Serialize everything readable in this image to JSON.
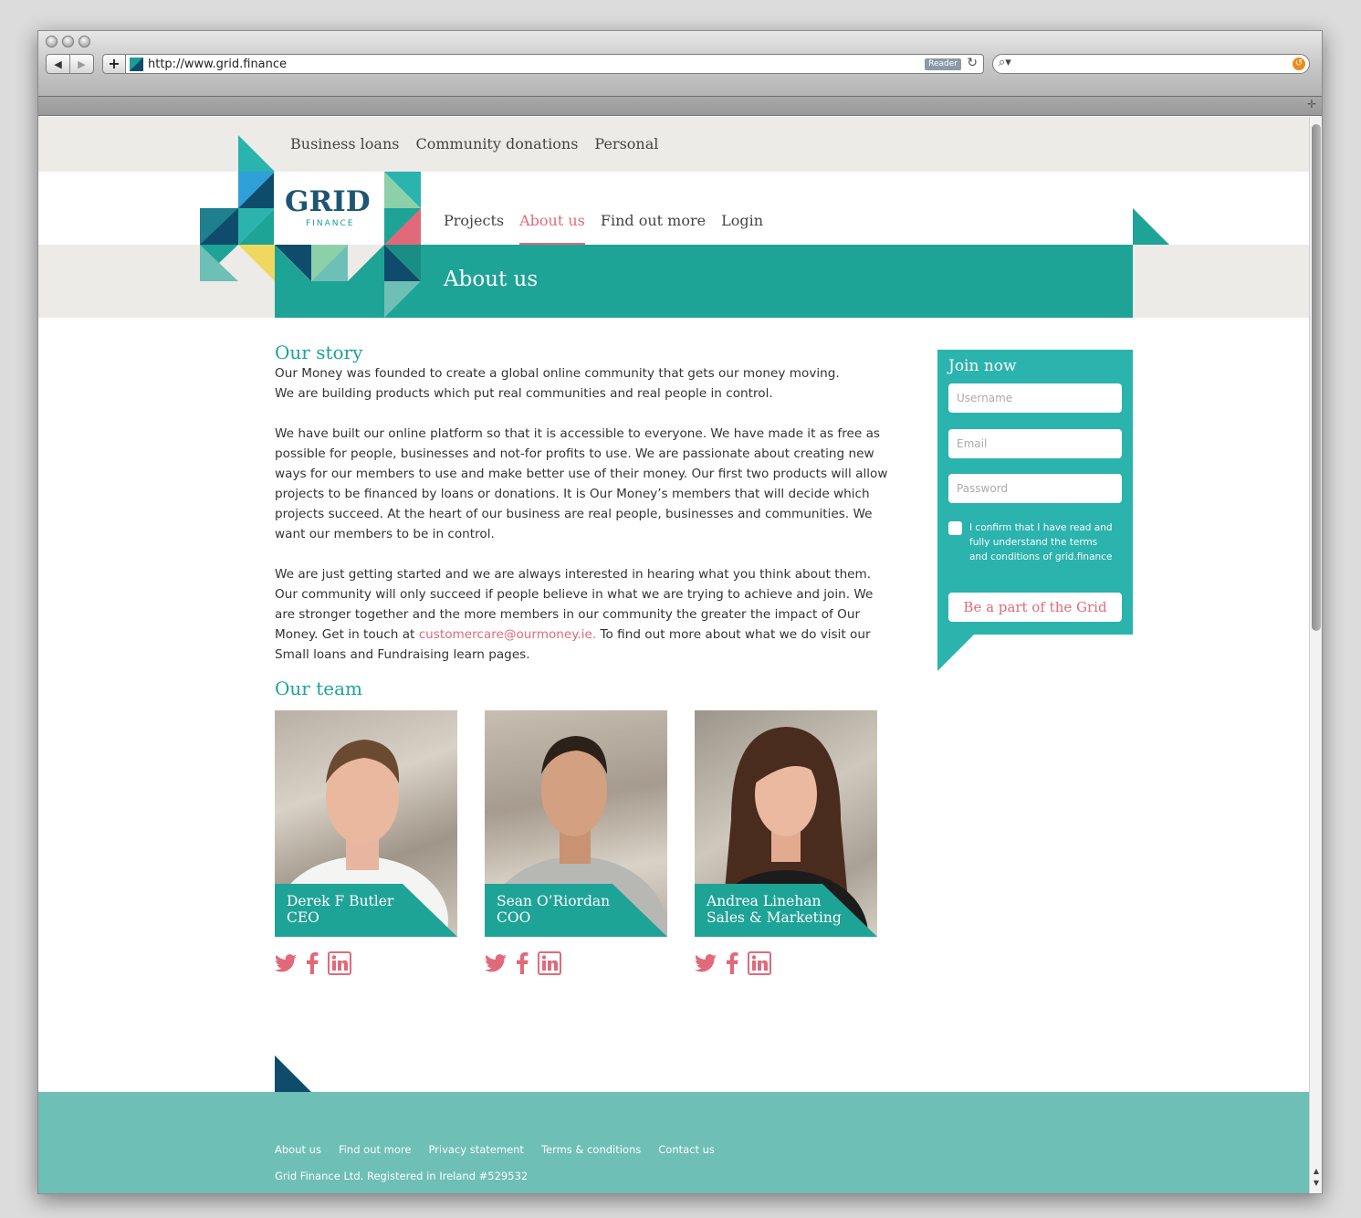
{
  "browser": {
    "url": "http://www.grid.finance",
    "reader_label": "Reader",
    "back_icon": "back-arrow-icon",
    "forward_icon": "forward-arrow-icon"
  },
  "site": {
    "top_nav": [
      "Business loans",
      "Community donations",
      "Personal"
    ],
    "logo_text": "GRID",
    "logo_sub": "FINANCE",
    "main_nav": [
      {
        "label": "Projects",
        "active": false
      },
      {
        "label": "About us",
        "active": true
      },
      {
        "label": "Find out more",
        "active": false
      },
      {
        "label": "Login",
        "active": false
      }
    ],
    "hero_title": "About us"
  },
  "story": {
    "heading": "Our story",
    "p1_line1": "Our Money was founded to create a global online community that gets our money moving.",
    "p1_line2": "We are building products which put real communities and real people in control.",
    "p2": "We have built our online platform so that it is accessible to everyone. We have made it as free as possible for people, businesses and not-for profits to use. We are passionate about creating new ways for our members to use and make better use of their money. Our first two products will allow projects to be financed by loans or donations. It is Our Money’s members that will decide which projects succeed. At the heart of our business are real people, businesses and communities. We want our members to be in control.",
    "p3_before": "We are just getting started and we are always interested in hearing what you think about them. Our community will only succeed if people believe in what we are trying to achieve and join. We are stronger together and the more members in our community the greater the impact of Our Money. Get in touch at ",
    "p3_email": "customercare@ourmoney.ie.",
    "p3_after": " To find out more about what we do visit our Small loans and Fundraising learn pages."
  },
  "team": {
    "heading": "Our team",
    "members": [
      {
        "name": "Derek F Butler",
        "role": "CEO"
      },
      {
        "name": "Sean O’Riordan",
        "role": "COO"
      },
      {
        "name": "Andrea Linehan",
        "role": "Sales & Marketing"
      }
    ]
  },
  "join": {
    "title": "Join now",
    "username_placeholder": "Username",
    "email_placeholder": "Email",
    "password_placeholder": "Password",
    "confirm_text": "I confirm that I have read and fully understand the terms and conditions of grid.finance",
    "cta": "Be a part of the Grid"
  },
  "footer": {
    "links": [
      "About us",
      "Find out more",
      "Privacy statement",
      "Terms & conditions",
      "Contact us"
    ],
    "copyright": "Grid Finance Ltd. Registered in Ireland #529532"
  },
  "colors": {
    "teal": "#1ea397",
    "teal_light": "#2bb3ae",
    "navy": "#0f4c6b",
    "pink": "#e06a7a",
    "footer": "#6ebfb6"
  }
}
